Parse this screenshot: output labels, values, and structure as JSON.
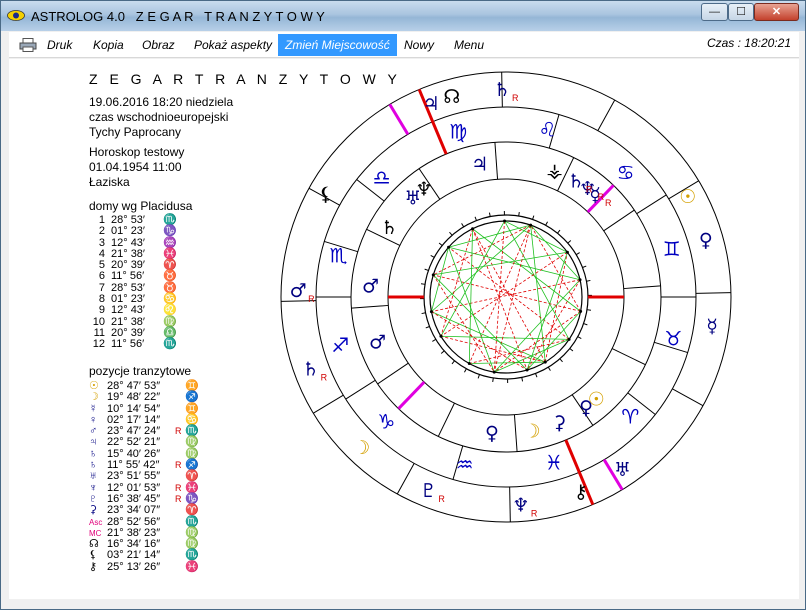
{
  "window": {
    "app_name": "ASTROLOG 4.0",
    "title": "Z E G A R   T R A N Z Y T O W Y",
    "min_glyph": "—",
    "max_glyph": "☐",
    "close_glyph": "✕"
  },
  "menu": {
    "items": [
      "Druk",
      "Kopia",
      "Obraz",
      "Pokaż aspekty",
      "Zmień Miejscowość",
      "Nowy",
      "Menu"
    ],
    "active": "Zmień Miejscowość",
    "time_label": "Czas : 18:20:21"
  },
  "info": {
    "title": "Z E G A R   T R A N Z Y T O W Y",
    "date_line": "19.06.2016   18:20   niedziela",
    "zone": "czas wschodnioeuropejski",
    "place": "Tychy Paprocany",
    "horoscope_label": "Horoskop testowy",
    "horoscope_date": "01.04.1954  11:00",
    "horoscope_place": "Łaziska",
    "houses_label": "domy wg Placidusa",
    "transits_label": "pozycje tranzytowe"
  },
  "houses": [
    {
      "n": "1",
      "deg": "28° 53′",
      "sign": "♏"
    },
    {
      "n": "2",
      "deg": "01° 23′",
      "sign": "♑"
    },
    {
      "n": "3",
      "deg": "12° 43′",
      "sign": "♒"
    },
    {
      "n": "4",
      "deg": "21° 38′",
      "sign": "♓"
    },
    {
      "n": "5",
      "deg": "20° 39′",
      "sign": "♈"
    },
    {
      "n": "6",
      "deg": "11° 56′",
      "sign": "♉"
    },
    {
      "n": "7",
      "deg": "28° 53′",
      "sign": "♉"
    },
    {
      "n": "8",
      "deg": "01° 23′",
      "sign": "♋"
    },
    {
      "n": "9",
      "deg": "12° 43′",
      "sign": "♌"
    },
    {
      "n": "10",
      "deg": "21° 38′",
      "sign": "♍"
    },
    {
      "n": "11",
      "deg": "20° 39′",
      "sign": "♎"
    },
    {
      "n": "12",
      "deg": "11° 56′",
      "sign": "♏"
    }
  ],
  "planets": [
    {
      "glyph": "☉",
      "color": "#d4a000",
      "deg": "28° 47′ 53″",
      "retro": "",
      "sign": "♊"
    },
    {
      "glyph": "☽",
      "color": "#d4a000",
      "deg": "19° 48′ 22″",
      "retro": "",
      "sign": "♐"
    },
    {
      "glyph": "☿",
      "color": "#000080",
      "deg": "10° 14′ 54″",
      "retro": "",
      "sign": "♊"
    },
    {
      "glyph": "♀",
      "color": "#000080",
      "deg": "02° 17′ 14″",
      "retro": "",
      "sign": "♋"
    },
    {
      "glyph": "♂",
      "color": "#000080",
      "deg": "23° 47′ 24″",
      "retro": "R",
      "sign": "♏"
    },
    {
      "glyph": "♃",
      "color": "#000080",
      "deg": "22° 52′ 21″",
      "retro": "",
      "sign": "♍"
    },
    {
      "glyph": "♄",
      "color": "#000080",
      "deg": "15° 40′ 26″",
      "retro": "",
      "sign": "♍"
    },
    {
      "glyph": "♄",
      "color": "#000080",
      "deg": "11° 55′ 42″",
      "retro": "R",
      "sign": "♐"
    },
    {
      "glyph": "♅",
      "color": "#000080",
      "deg": "23° 51′ 55″",
      "retro": "",
      "sign": "♈"
    },
    {
      "glyph": "♆",
      "color": "#000080",
      "deg": "12° 01′ 53″",
      "retro": "R",
      "sign": "♓"
    },
    {
      "glyph": "♇",
      "color": "#000080",
      "deg": "16° 38′ 45″",
      "retro": "R",
      "sign": "♑"
    },
    {
      "glyph": "⚳",
      "color": "#000080",
      "deg": "23° 34′ 07″",
      "retro": "",
      "sign": "♈"
    },
    {
      "glyph": "Asc",
      "color": "#e0007a",
      "deg": "28° 52′ 56″",
      "retro": "",
      "sign": "♏"
    },
    {
      "glyph": "MC",
      "color": "#e0007a",
      "deg": "21° 38′ 23″",
      "retro": "",
      "sign": "♍"
    },
    {
      "glyph": "☊",
      "color": "#000000",
      "deg": "16° 34′ 16″",
      "retro": "",
      "sign": "♍"
    },
    {
      "glyph": "⚸",
      "color": "#000000",
      "deg": "03° 21′ 14″",
      "retro": "",
      "sign": "♏"
    },
    {
      "glyph": "⚷",
      "color": "#000000",
      "deg": "25° 13′ 26″",
      "retro": "",
      "sign": "♓"
    }
  ],
  "chart_data": {
    "zodiac_signs": [
      "♈",
      "♉",
      "♊",
      "♋",
      "♌",
      "♍",
      "♎",
      "♏",
      "♐",
      "♑",
      "♒",
      "♓"
    ],
    "retro_mark": "R",
    "natal_points": [
      {
        "glyph": "☉",
        "lon": 10.5,
        "color": "#d4a000"
      },
      {
        "glyph": "♀",
        "lon": 5,
        "color": "#000080"
      },
      {
        "glyph": "⚳",
        "lon": 352,
        "color": "#000080"
      },
      {
        "glyph": "☽",
        "lon": 340,
        "color": "#d4a000"
      },
      {
        "glyph": "♀",
        "lon": 323,
        "color": "#000080"
      },
      {
        "glyph": "♄",
        "lon": 208,
        "color": "#000000"
      },
      {
        "glyph": "♂",
        "lon": 234,
        "color": "#000080"
      },
      {
        "glyph": "♂",
        "lon": 258,
        "color": "#000080"
      },
      {
        "glyph": "☿",
        "lon": 108,
        "color": "#000080",
        "retro": true
      },
      {
        "glyph": "♆",
        "lon": 112,
        "color": "#000080",
        "retro": true
      },
      {
        "glyph": "♄",
        "lon": 118,
        "color": "#000080",
        "retro": true
      },
      {
        "glyph": "⚶",
        "lon": 128,
        "color": "#000000"
      },
      {
        "glyph": "♅",
        "lon": 192,
        "color": "#000080"
      },
      {
        "glyph": "♆",
        "lon": 186,
        "color": "#000000"
      },
      {
        "glyph": "♃",
        "lon": 160,
        "color": "#000080"
      }
    ],
    "transit_points": [
      {
        "glyph": "♅",
        "lon": 3,
        "color": "#000080"
      },
      {
        "glyph": "⚷",
        "lon": 350,
        "color": "#000000"
      },
      {
        "glyph": "♆",
        "lon": 333,
        "color": "#000080",
        "retro": true
      },
      {
        "glyph": "♇",
        "lon": 307,
        "color": "#000080",
        "retro": true
      },
      {
        "glyph": "☽",
        "lon": 285,
        "color": "#d4a000"
      },
      {
        "glyph": "♄",
        "lon": 259,
        "color": "#000080",
        "retro": true
      },
      {
        "glyph": "♂",
        "lon": 237,
        "color": "#000080",
        "retro": true
      },
      {
        "glyph": "⚸",
        "lon": 209,
        "color": "#000000"
      },
      {
        "glyph": "♃",
        "lon": 170,
        "color": "#000080"
      },
      {
        "glyph": "☊",
        "lon": 164,
        "color": "#000000"
      },
      {
        "glyph": "♄",
        "lon": 150,
        "color": "#000080",
        "retro": true
      },
      {
        "glyph": "☉",
        "lon": 88,
        "color": "#d4a000"
      },
      {
        "glyph": "♀",
        "lon": 75,
        "color": "#000080"
      },
      {
        "glyph": "☿",
        "lon": 51,
        "color": "#000080"
      }
    ],
    "axes": {
      "asc": 238.9,
      "mc": 171.6,
      "natal_asc": 180
    }
  }
}
